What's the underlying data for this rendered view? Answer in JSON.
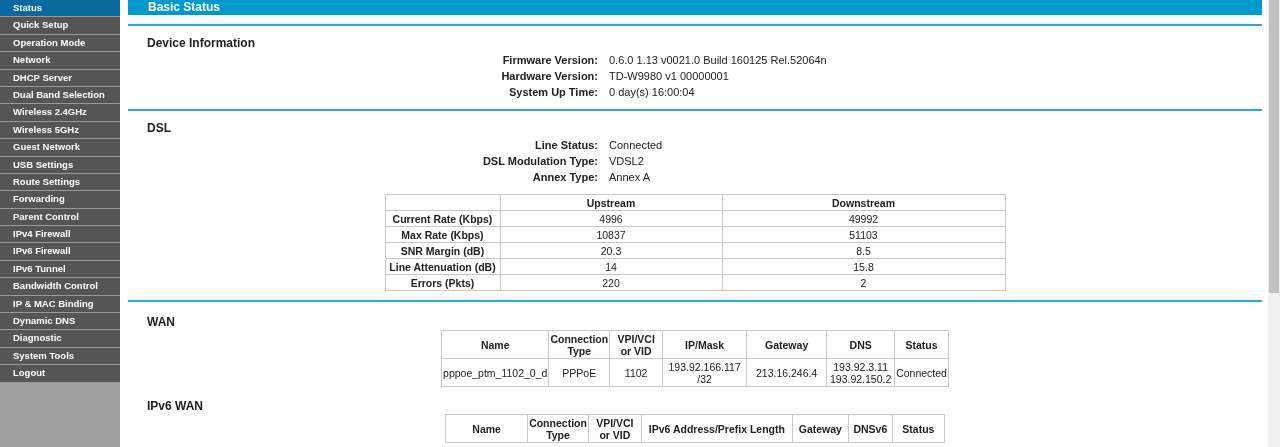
{
  "sidebar": {
    "items": [
      {
        "label": "Status",
        "selected": true
      },
      {
        "label": "Quick Setup",
        "selected": false
      },
      {
        "label": "Operation Mode",
        "selected": false
      },
      {
        "label": "Network",
        "selected": false
      },
      {
        "label": "DHCP Server",
        "selected": false
      },
      {
        "label": "Dual Band Selection",
        "selected": false
      },
      {
        "label": "Wireless 2.4GHz",
        "selected": false
      },
      {
        "label": "Wireless 5GHz",
        "selected": false
      },
      {
        "label": "Guest Network",
        "selected": false
      },
      {
        "label": "USB Settings",
        "selected": false
      },
      {
        "label": "Route Settings",
        "selected": false
      },
      {
        "label": "Forwarding",
        "selected": false
      },
      {
        "label": "Parent Control",
        "selected": false
      },
      {
        "label": "IPv4 Firewall",
        "selected": false
      },
      {
        "label": "IPv6 Firewall",
        "selected": false
      },
      {
        "label": "IPv6 Tunnel",
        "selected": false
      },
      {
        "label": "Bandwidth Control",
        "selected": false
      },
      {
        "label": "IP & MAC Binding",
        "selected": false
      },
      {
        "label": "Dynamic DNS",
        "selected": false
      },
      {
        "label": "Diagnostic",
        "selected": false
      },
      {
        "label": "System Tools",
        "selected": false
      },
      {
        "label": "Logout",
        "selected": false
      }
    ]
  },
  "header": {
    "title": "Basic Status"
  },
  "sections": [
    {
      "kind": "info",
      "divider": true,
      "title": "Device Information",
      "fields": [
        {
          "label": "Firmware Version:",
          "value": "0.6.0 1.13 v0021.0 Build 160125 Rel.52064n"
        },
        {
          "label": "Hardware Version:",
          "value": "TD-W9980 v1 00000001"
        },
        {
          "label": "System Up Time:",
          "value": "0 day(s) 16:00:04"
        }
      ]
    },
    {
      "kind": "info",
      "divider": true,
      "title": "DSL",
      "fields": [
        {
          "label": "Line Status:",
          "value": "Connected"
        },
        {
          "label": "DSL Modulation Type:",
          "value": "VDSL2"
        },
        {
          "label": "Annex Type:",
          "value": "Annex A"
        }
      ],
      "table": {
        "columns": [
          "",
          "Upstream",
          "Downstream"
        ],
        "rows": [
          [
            "Current Rate (Kbps)",
            "4996",
            "49992"
          ],
          [
            "Max Rate (Kbps)",
            "10837",
            "51103"
          ],
          [
            "SNR Margin (dB)",
            "20.3",
            "8.5"
          ],
          [
            "Line Attenuation (dB)",
            "14",
            "15.8"
          ],
          [
            "Errors (Pkts)",
            "220",
            "2"
          ]
        ]
      }
    },
    {
      "kind": "table",
      "divider": true,
      "title": "WAN",
      "table": {
        "columns": [
          "Name",
          "Connection Type",
          "VPI/VCI or VID",
          "IP/Mask",
          "Gateway",
          "DNS",
          "Status"
        ],
        "rows": [
          [
            "pppoe_ptm_1102_0_d",
            "PPPoE",
            "1102",
            "193.92.166.117 /32",
            "213.16.246.4",
            "193.92.3.11 193.92.150.2",
            "Connected"
          ]
        ]
      }
    },
    {
      "kind": "table",
      "divider": false,
      "title": "IPv6 WAN",
      "table": {
        "columns": [
          "Name",
          "Connection Type",
          "VPI/VCI or VID",
          "IPv6 Address/Prefix Length",
          "Gateway",
          "DNSv6",
          "Status"
        ]
      }
    }
  ]
}
